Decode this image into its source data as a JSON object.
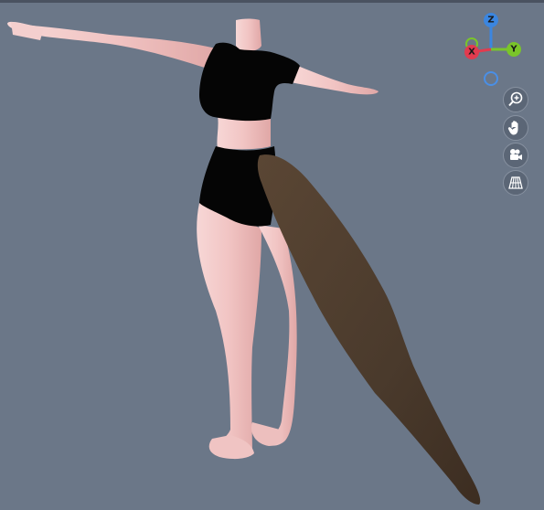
{
  "viewport": {
    "background_color": "#6b7788"
  },
  "gizmo": {
    "z_label": "Z",
    "x_label": "X",
    "y_label": "Y",
    "z_color": "#3b86e0",
    "x_color": "#e23b4f",
    "y_color": "#7ac52a",
    "neg_color": "#4a8fe6"
  },
  "toolbar": {
    "buttons": [
      {
        "icon": "zoom-icon"
      },
      {
        "icon": "hand-pan-icon"
      },
      {
        "icon": "camera-icon"
      },
      {
        "icon": "grid-icon"
      }
    ]
  },
  "model": {
    "skin_color": "#f1c4c3",
    "clothing_color": "#050505",
    "tail_color": "#4a3a2c"
  }
}
